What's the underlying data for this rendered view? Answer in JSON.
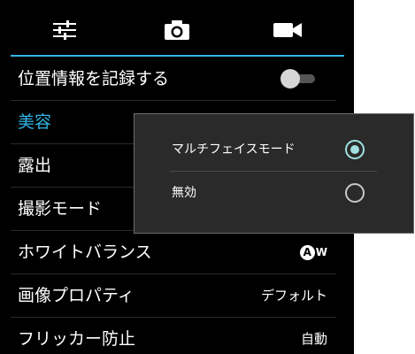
{
  "tabs": [
    {
      "name": "settings",
      "icon": "sliders-icon"
    },
    {
      "name": "photo",
      "icon": "camera-icon"
    },
    {
      "name": "video",
      "icon": "video-camera-icon"
    }
  ],
  "accent_color": "#33b5e5",
  "settings": {
    "location_label": "位置情報を記録する",
    "location_enabled": false,
    "beauty_label": "美容",
    "exposure_label": "露出",
    "mode_label": "撮影モード",
    "white_balance_label": "ホワイトバランス",
    "white_balance_icon_letter": "A",
    "white_balance_icon_suffix": "W",
    "image_props_label": "画像プロパティ",
    "image_props_value": "デフォルト",
    "flicker_label": "フリッカー防止",
    "flicker_value": "自動"
  },
  "popup": {
    "options": [
      {
        "label": "マルチフェイスモード",
        "selected": true
      },
      {
        "label": "無効",
        "selected": false
      }
    ],
    "radio_selected_color": "#9fe0df"
  }
}
